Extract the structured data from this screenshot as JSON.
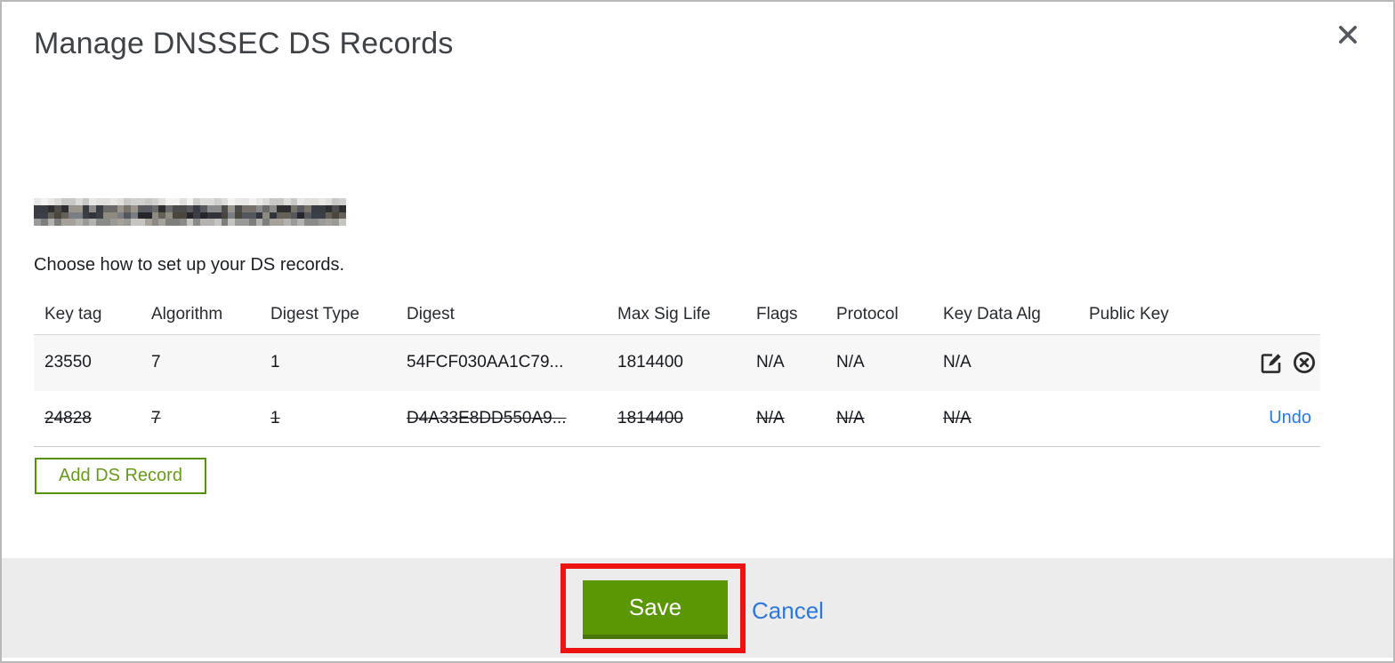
{
  "dialog": {
    "title": "Manage DNSSEC DS Records",
    "intro": "Choose how to set up your DS records.",
    "domain_redacted": true
  },
  "table": {
    "headers": [
      "Key tag",
      "Algorithm",
      "Digest Type",
      "Digest",
      "Max Sig Life",
      "Flags",
      "Protocol",
      "Key Data Alg",
      "Public Key"
    ],
    "rows": [
      {
        "key_tag": "23550",
        "algorithm": "7",
        "digest_type": "1",
        "digest": "54FCF030AA1C79...",
        "max_sig_life": "1814400",
        "flags": "N/A",
        "protocol": "N/A",
        "key_data_alg": "N/A",
        "public_key": "",
        "state": "active",
        "actions": [
          "edit",
          "delete"
        ]
      },
      {
        "key_tag": "24828",
        "algorithm": "7",
        "digest_type": "1",
        "digest": "D4A33E8DD550A9...",
        "max_sig_life": "1814400",
        "flags": "N/A",
        "protocol": "N/A",
        "key_data_alg": "N/A",
        "public_key": "",
        "state": "deleted",
        "undo_label": "Undo"
      }
    ]
  },
  "buttons": {
    "add_ds_record": "Add DS Record",
    "save": "Save",
    "cancel": "Cancel"
  },
  "icons": {
    "close": "close-icon",
    "edit": "edit-icon",
    "delete": "delete-circle-icon"
  },
  "annotations": {
    "save_button_highlighted": true,
    "highlight_color": "#ee1313"
  },
  "colors": {
    "save_green": "#5b9604",
    "save_green_dark": "#47770a",
    "add_button_green": "#569203",
    "link_blue": "#2d78e0",
    "footer_gray": "#ececec",
    "row_stripe": "#f7f7f7",
    "title_gray": "#3f4246"
  }
}
